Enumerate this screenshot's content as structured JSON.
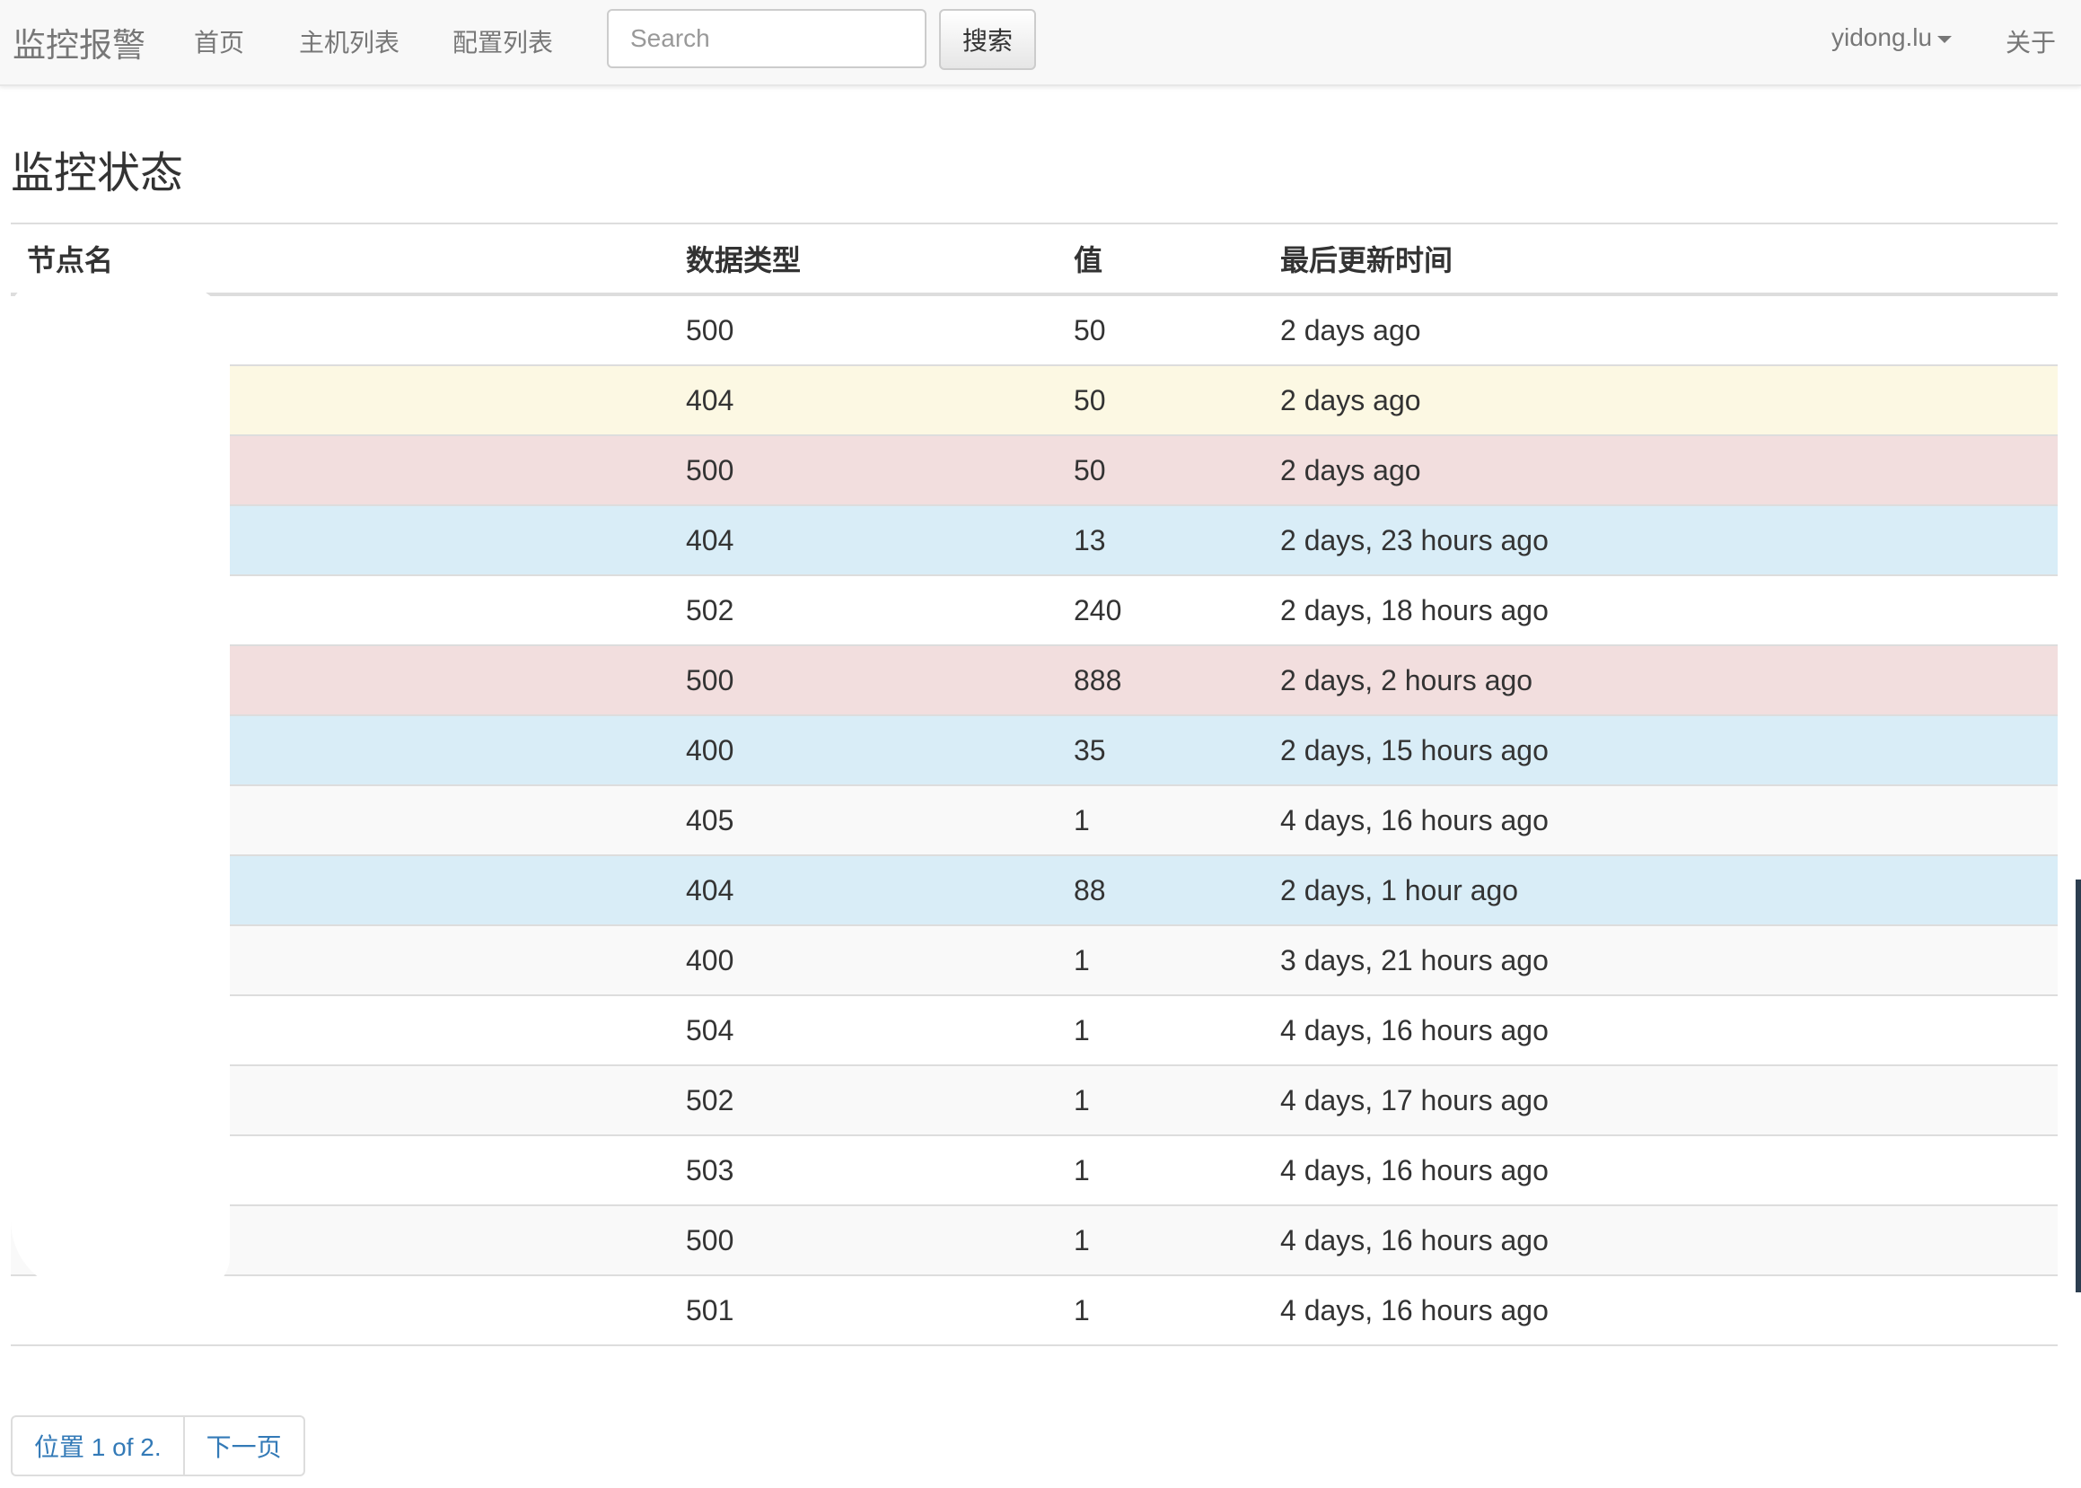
{
  "navbar": {
    "brand": "监控报警",
    "links": [
      "首页",
      "主机列表",
      "配置列表"
    ],
    "search": {
      "placeholder": "Search",
      "value": ""
    },
    "search_button": "搜索",
    "user": "yidong.lu",
    "about": "关于"
  },
  "page_title": "监控状态",
  "table": {
    "headers": [
      "节点名",
      "数据类型",
      "值",
      "最后更新时间"
    ],
    "rows": [
      {
        "node": "",
        "type": "500",
        "value": "50",
        "updated": "2 days ago",
        "style": "default"
      },
      {
        "node": "",
        "type": "404",
        "value": "50",
        "updated": "2 days ago",
        "style": "warning"
      },
      {
        "node": "",
        "type": "500",
        "value": "50",
        "updated": "2 days ago",
        "style": "danger"
      },
      {
        "node": "",
        "type": "404",
        "value": "13",
        "updated": "2 days, 23 hours ago",
        "style": "info"
      },
      {
        "node": "",
        "type": "502",
        "value": "240",
        "updated": "2 days, 18 hours ago",
        "style": "default"
      },
      {
        "node": "",
        "type": "500",
        "value": "888",
        "updated": "2 days, 2 hours ago",
        "style": "danger"
      },
      {
        "node": "",
        "type": "400",
        "value": "35",
        "updated": "2 days, 15 hours ago",
        "style": "info"
      },
      {
        "node": "",
        "type": "405",
        "value": "1",
        "updated": "4 days, 16 hours ago",
        "style": "striped"
      },
      {
        "node": "",
        "type": "404",
        "value": "88",
        "updated": "2 days, 1 hour ago",
        "style": "info"
      },
      {
        "node": "",
        "type": "400",
        "value": "1",
        "updated": "3 days, 21 hours ago",
        "style": "striped"
      },
      {
        "node": "",
        "type": "504",
        "value": "1",
        "updated": "4 days, 16 hours ago",
        "style": "default"
      },
      {
        "node": "",
        "type": "502",
        "value": "1",
        "updated": "4 days, 17 hours ago",
        "style": "striped"
      },
      {
        "node": "",
        "type": "503",
        "value": "1",
        "updated": "4 days, 16 hours ago",
        "style": "default"
      },
      {
        "node": "",
        "type": "500",
        "value": "1",
        "updated": "4 days, 16 hours ago",
        "style": "striped"
      },
      {
        "node": "",
        "type": "501",
        "value": "1",
        "updated": "4 days, 16 hours ago",
        "style": "default"
      }
    ]
  },
  "pager": {
    "position": "位置 1 of 2.",
    "next": "下一页"
  },
  "colors": {
    "warning": "#fcf8e3",
    "danger": "#f2dede",
    "info": "#d9edf7",
    "striped": "#f9f9f9",
    "link": "#337ab7"
  }
}
